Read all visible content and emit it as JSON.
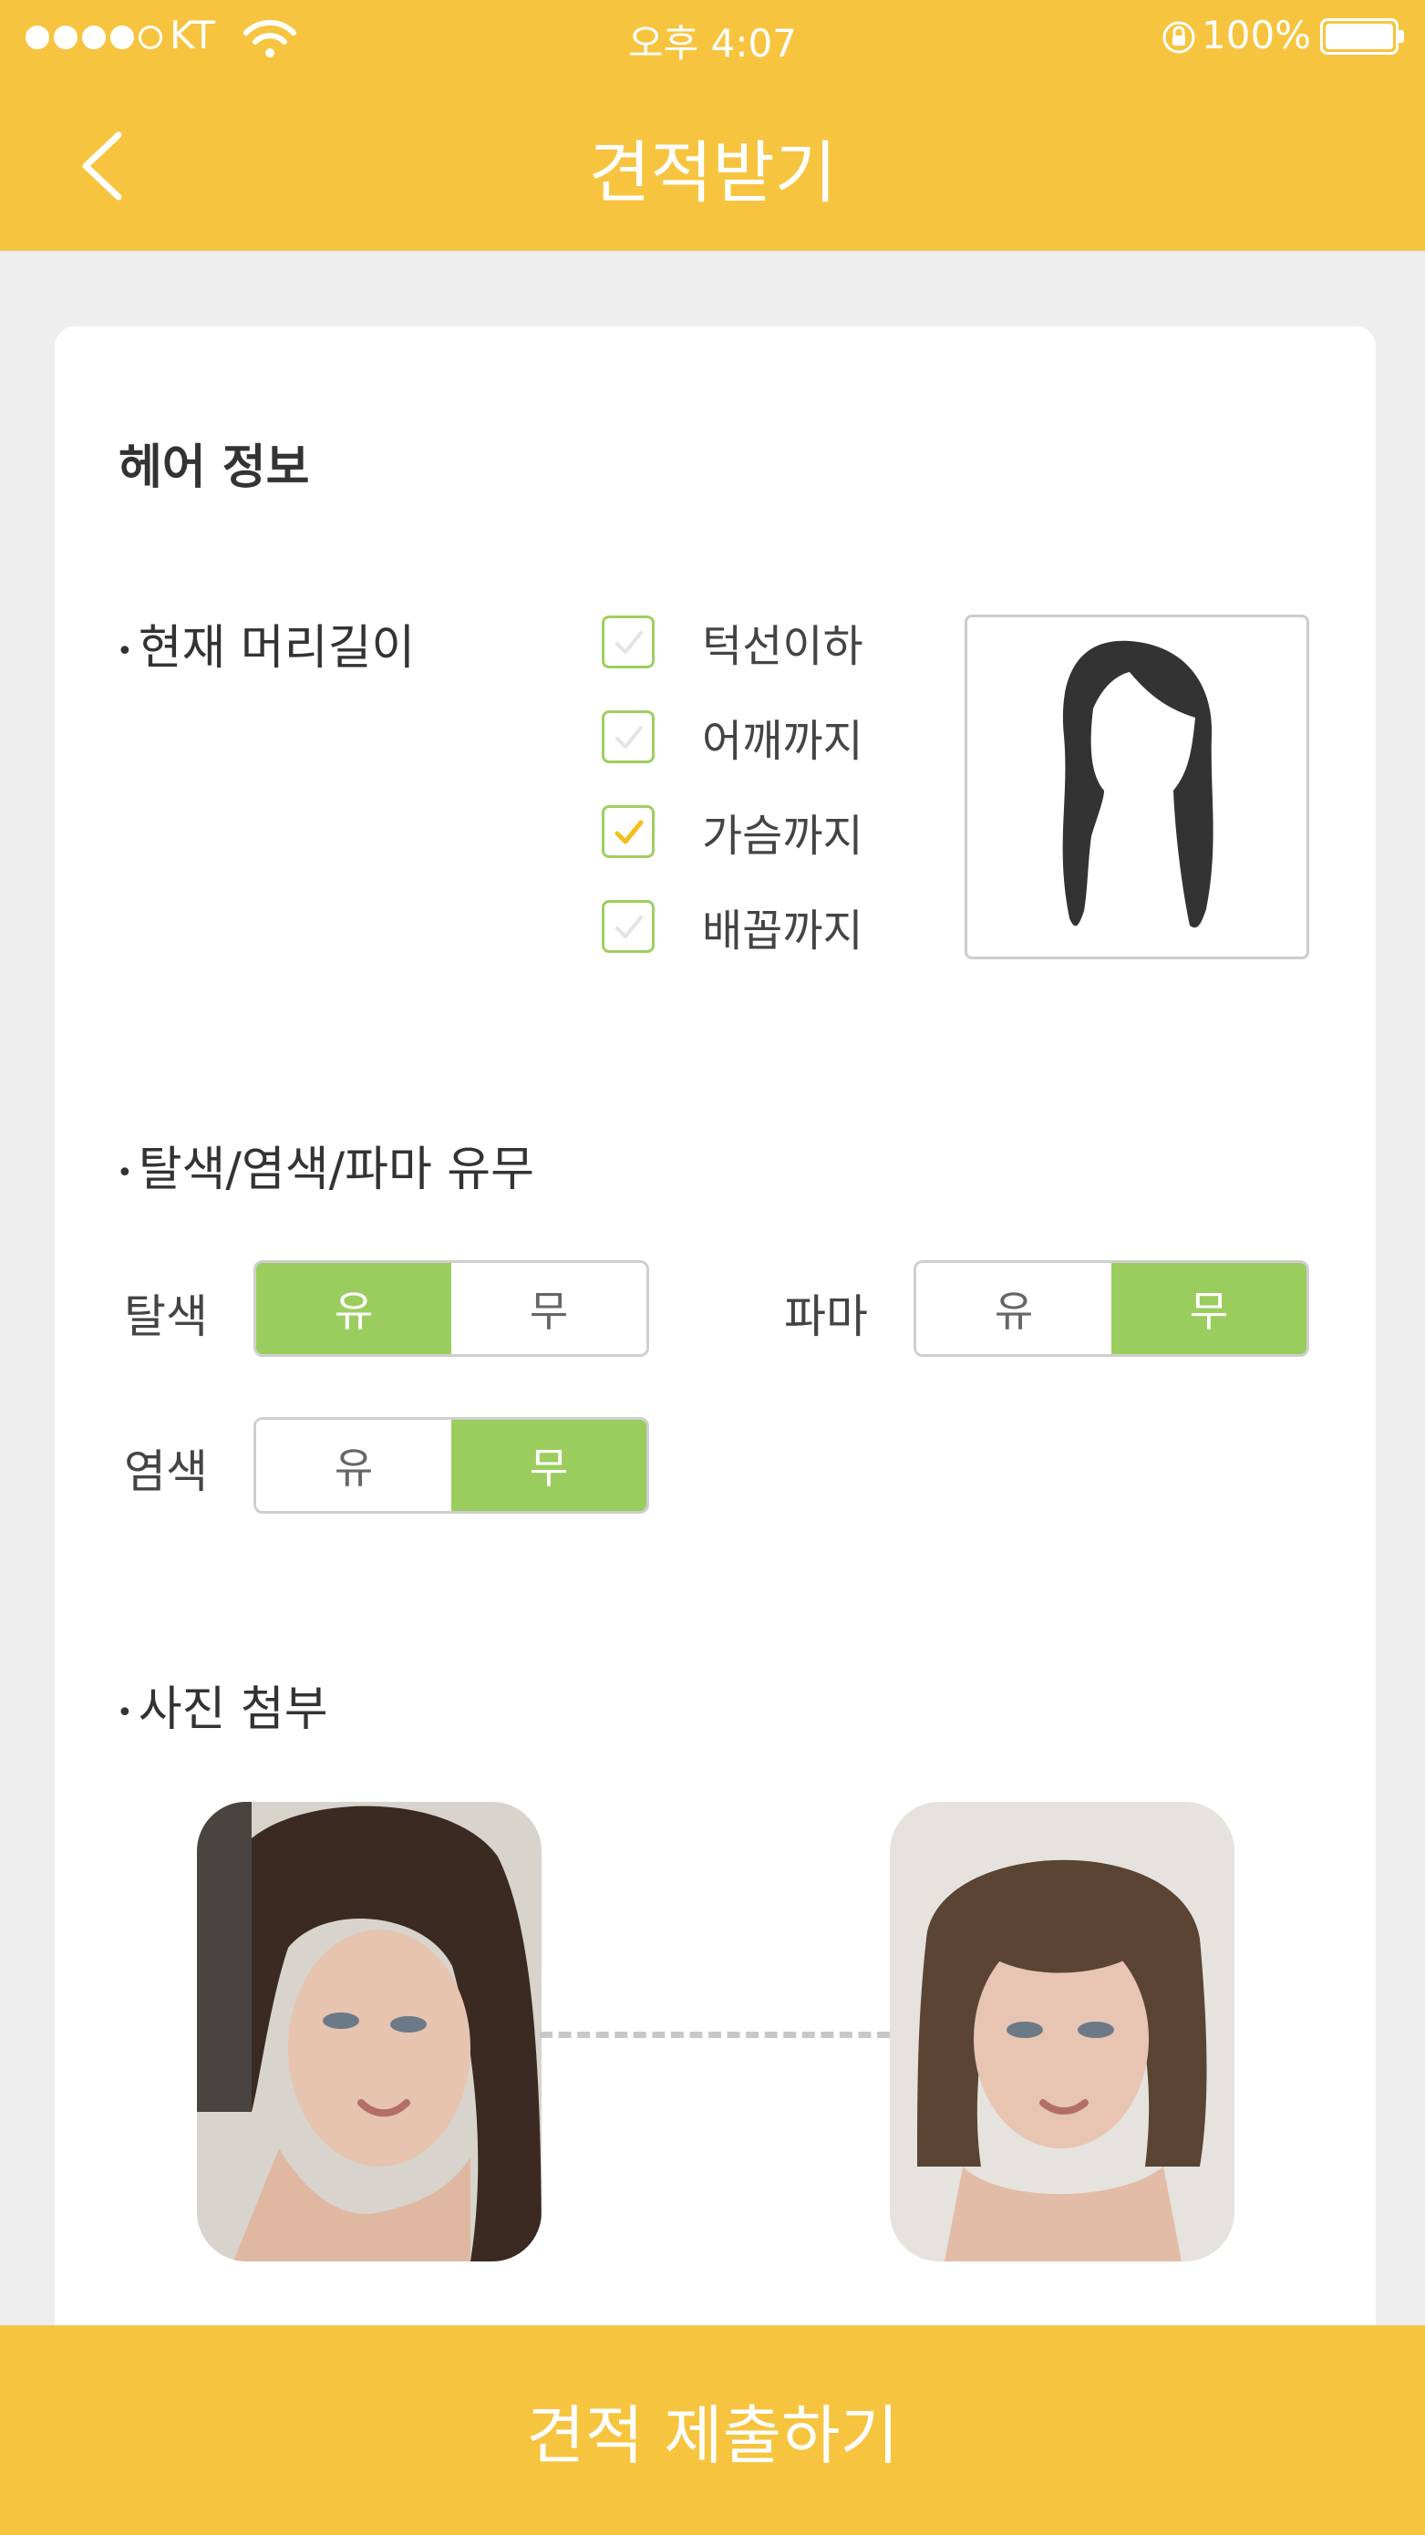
{
  "status_bar": {
    "carrier": "KT",
    "time": "오후 4:07",
    "battery": "100%"
  },
  "header": {
    "title": "견적받기",
    "back_icon": "chevron-left-icon"
  },
  "hair_info": {
    "section_title": "헤어 정보",
    "length": {
      "label": "현재 머리길이",
      "options": [
        {
          "label": "턱선이하",
          "checked": false
        },
        {
          "label": "어깨까지",
          "checked": false
        },
        {
          "label": "가슴까지",
          "checked": true
        },
        {
          "label": "배꼽까지",
          "checked": false
        }
      ],
      "preview_icon": "long-hair-silhouette-icon"
    },
    "treatment": {
      "label": "탈색/염색/파마 유무",
      "bleach": {
        "label": "탈색",
        "yes": "유",
        "no": "무",
        "selected": "유"
      },
      "perm": {
        "label": "파마",
        "yes": "유",
        "no": "무",
        "selected": "무"
      },
      "dye": {
        "label": "염색",
        "yes": "유",
        "no": "무",
        "selected": "무"
      }
    },
    "photos": {
      "label": "사진 첨부",
      "items": [
        "current-hair-photo",
        "reference-hair-photo"
      ]
    }
  },
  "footer": {
    "submit_label": "견적 제출하기"
  },
  "colors": {
    "brand_yellow": "#f6c43f",
    "selected_green": "#9acd5d",
    "check_yellow": "#f5bd1f"
  }
}
